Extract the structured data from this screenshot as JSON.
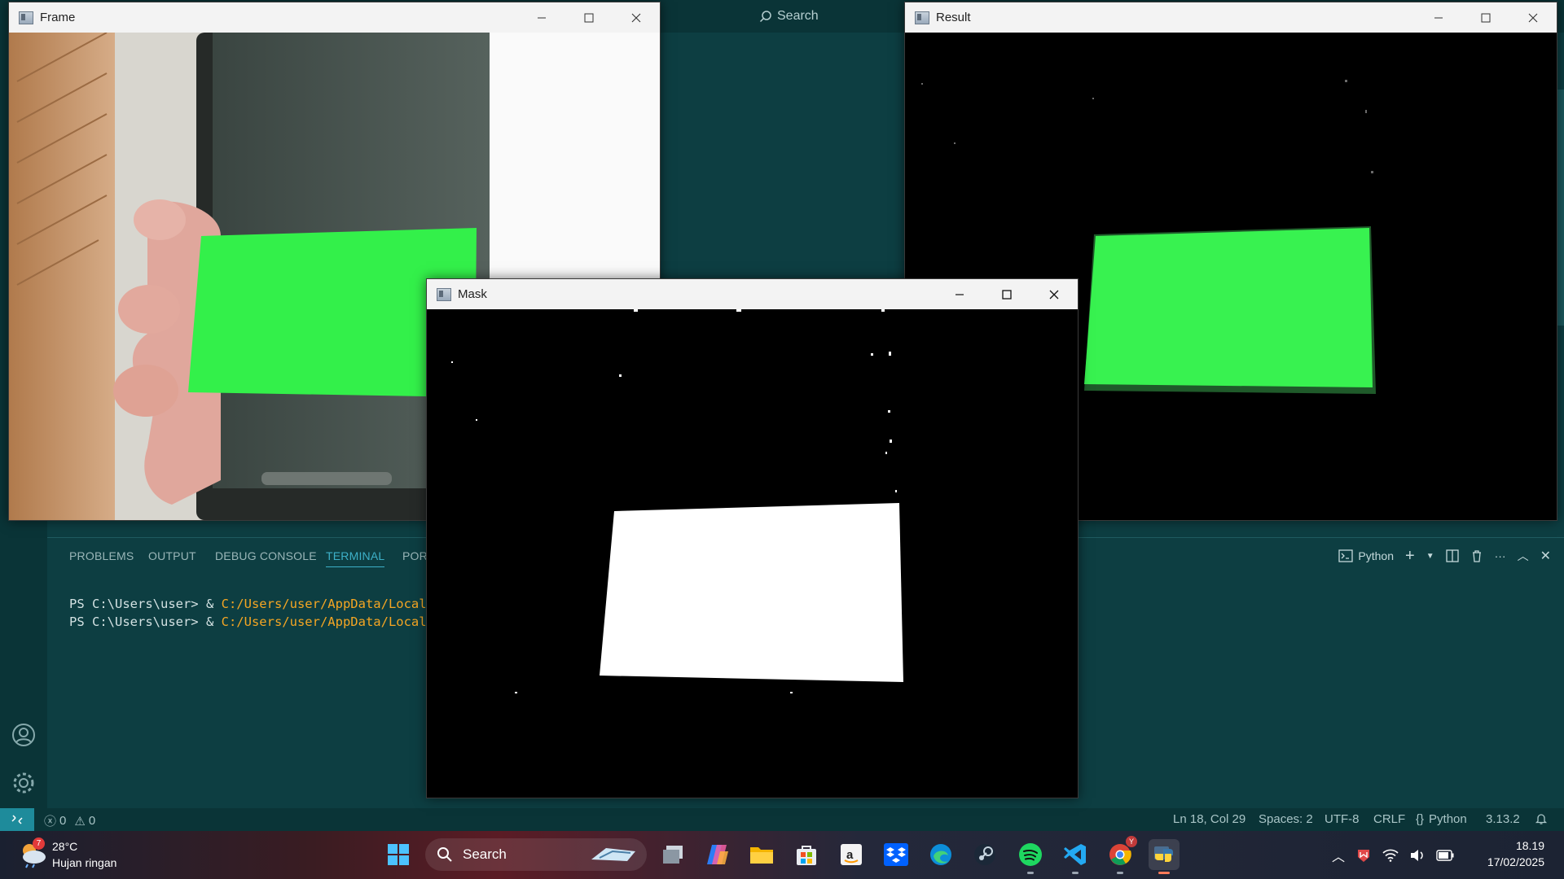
{
  "vscode": {
    "search_label": "Search",
    "panel": {
      "tabs": [
        "PROBLEMS",
        "OUTPUT",
        "DEBUG CONSOLE",
        "TERMINAL",
        "PORTS"
      ],
      "active_tab": "TERMINAL",
      "terminal_profile": "Python",
      "terminal_lines": [
        {
          "prompt": "PS C:\\Users\\user> & ",
          "path": "C:/Users/user/AppData/Local/P"
        },
        {
          "prompt": "PS C:\\Users\\user> & ",
          "path": "C:/Users/user/AppData/Local/P"
        }
      ]
    },
    "statusbar": {
      "errors": "0",
      "warnings": "0",
      "cursor": "Ln 18, Col 29",
      "spaces": "Spaces: 2",
      "encoding": "UTF-8",
      "eol": "CRLF",
      "language": "Python",
      "interpreter": "3.13.2"
    }
  },
  "windows": {
    "frame": {
      "title": "Frame"
    },
    "result": {
      "title": "Result"
    },
    "mask": {
      "title": "Mask"
    }
  },
  "taskbar": {
    "weather": {
      "temp": "28°C",
      "desc": "Hujan ringan",
      "badge": "7"
    },
    "search_label": "Search",
    "chrome_badge": "Y",
    "clock": {
      "time": "18.19",
      "date": "17/02/2025"
    }
  },
  "colors": {
    "accent": "#3db0c8",
    "green_screen": "#33f04a",
    "term_path": "#f5a623"
  }
}
